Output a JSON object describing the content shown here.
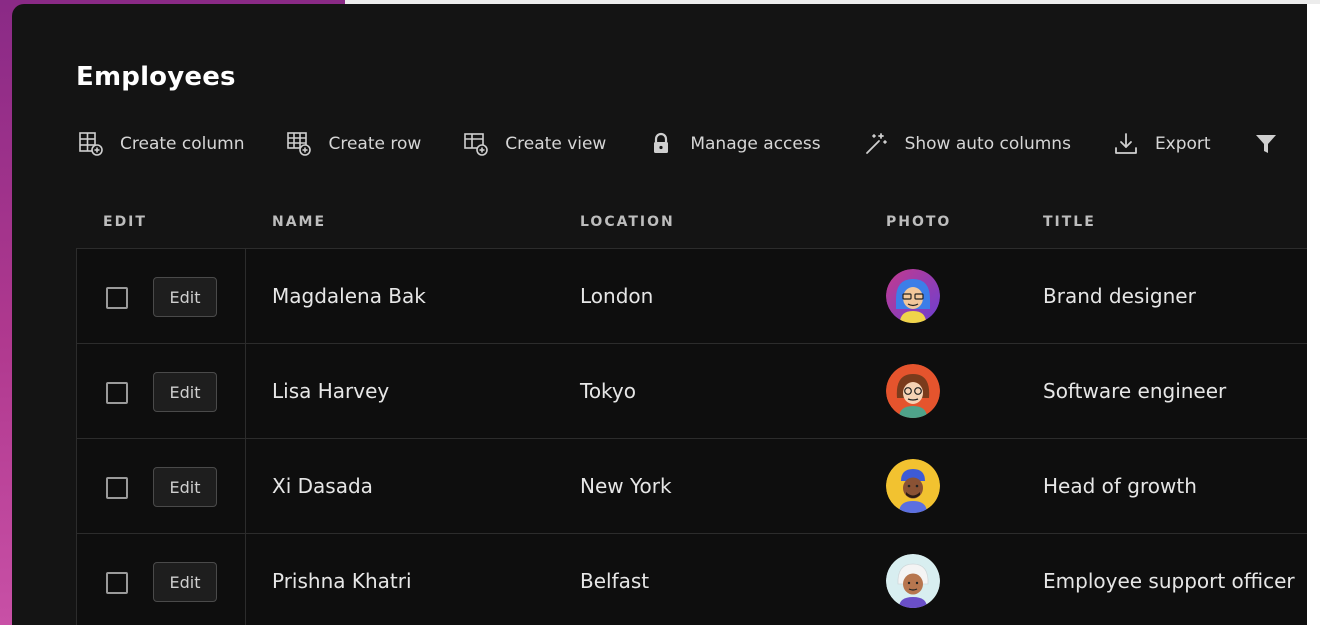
{
  "page": {
    "title": "Employees"
  },
  "toolbar": {
    "create_column": "Create column",
    "create_row": "Create row",
    "create_view": "Create view",
    "manage_access": "Manage access",
    "show_auto_columns": "Show auto columns",
    "export": "Export"
  },
  "table": {
    "headers": {
      "edit": "EDIT",
      "name": "NAME",
      "location": "LOCATION",
      "photo": "PHOTO",
      "title": "TITLE"
    },
    "edit_label": "Edit",
    "rows": [
      {
        "name": "Magdalena Bak",
        "location": "London",
        "title": "Brand designer"
      },
      {
        "name": "Lisa Harvey",
        "location": "Tokyo",
        "title": "Software engineer"
      },
      {
        "name": "Xi Dasada",
        "location": "New York",
        "title": "Head of growth"
      },
      {
        "name": "Prishna Khatri",
        "location": "Belfast",
        "title": "Employee support officer"
      }
    ]
  },
  "colors": {
    "panel_bg": "#141414",
    "row_bg": "#0e0e0e",
    "border": "#2c2c2c",
    "gradient_start": "#8a2a86",
    "gradient_end": "#c850a6"
  },
  "icons": [
    "create-column-icon",
    "create-row-icon",
    "create-view-icon",
    "lock-icon",
    "magic-wand-icon",
    "download-icon",
    "filter-icon"
  ]
}
